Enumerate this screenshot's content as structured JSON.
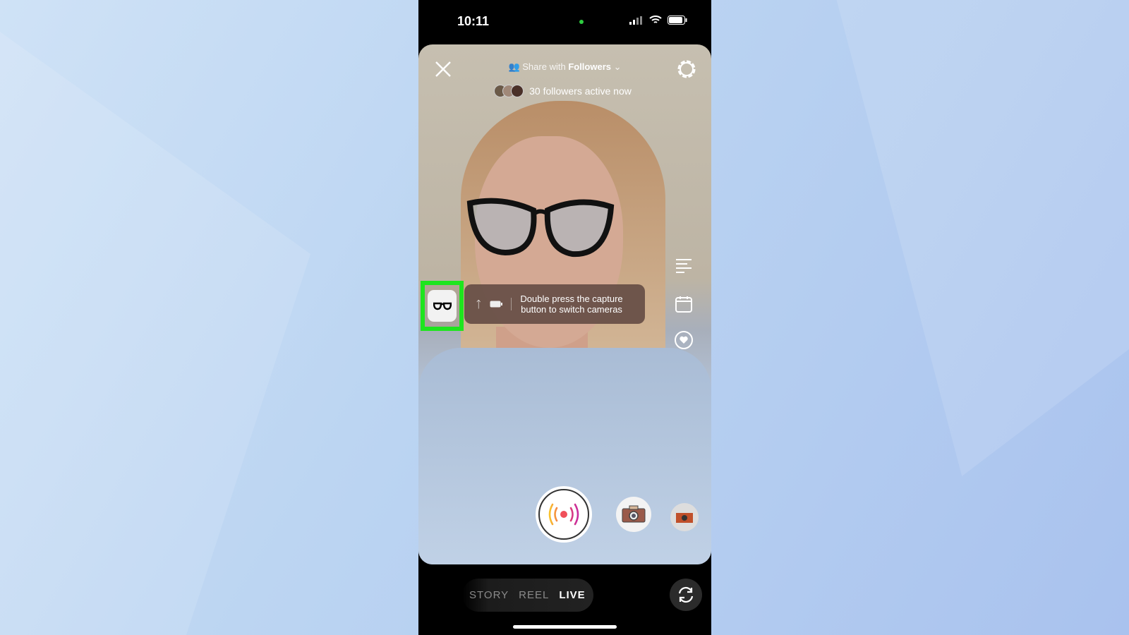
{
  "status_bar": {
    "time": "10:11"
  },
  "header": {
    "share_prefix": "Share with",
    "share_audience": "Followers",
    "followers_active": "30 followers active now"
  },
  "tooltip": {
    "line1": "Double press the capture",
    "line2": "button to switch cameras"
  },
  "modes": [
    {
      "label": "STORY",
      "active": false
    },
    {
      "label": "REEL",
      "active": false
    },
    {
      "label": "LIVE",
      "active": true
    }
  ],
  "colors": {
    "highlight": "#1ee51e",
    "live_dot": "#f0505a"
  }
}
